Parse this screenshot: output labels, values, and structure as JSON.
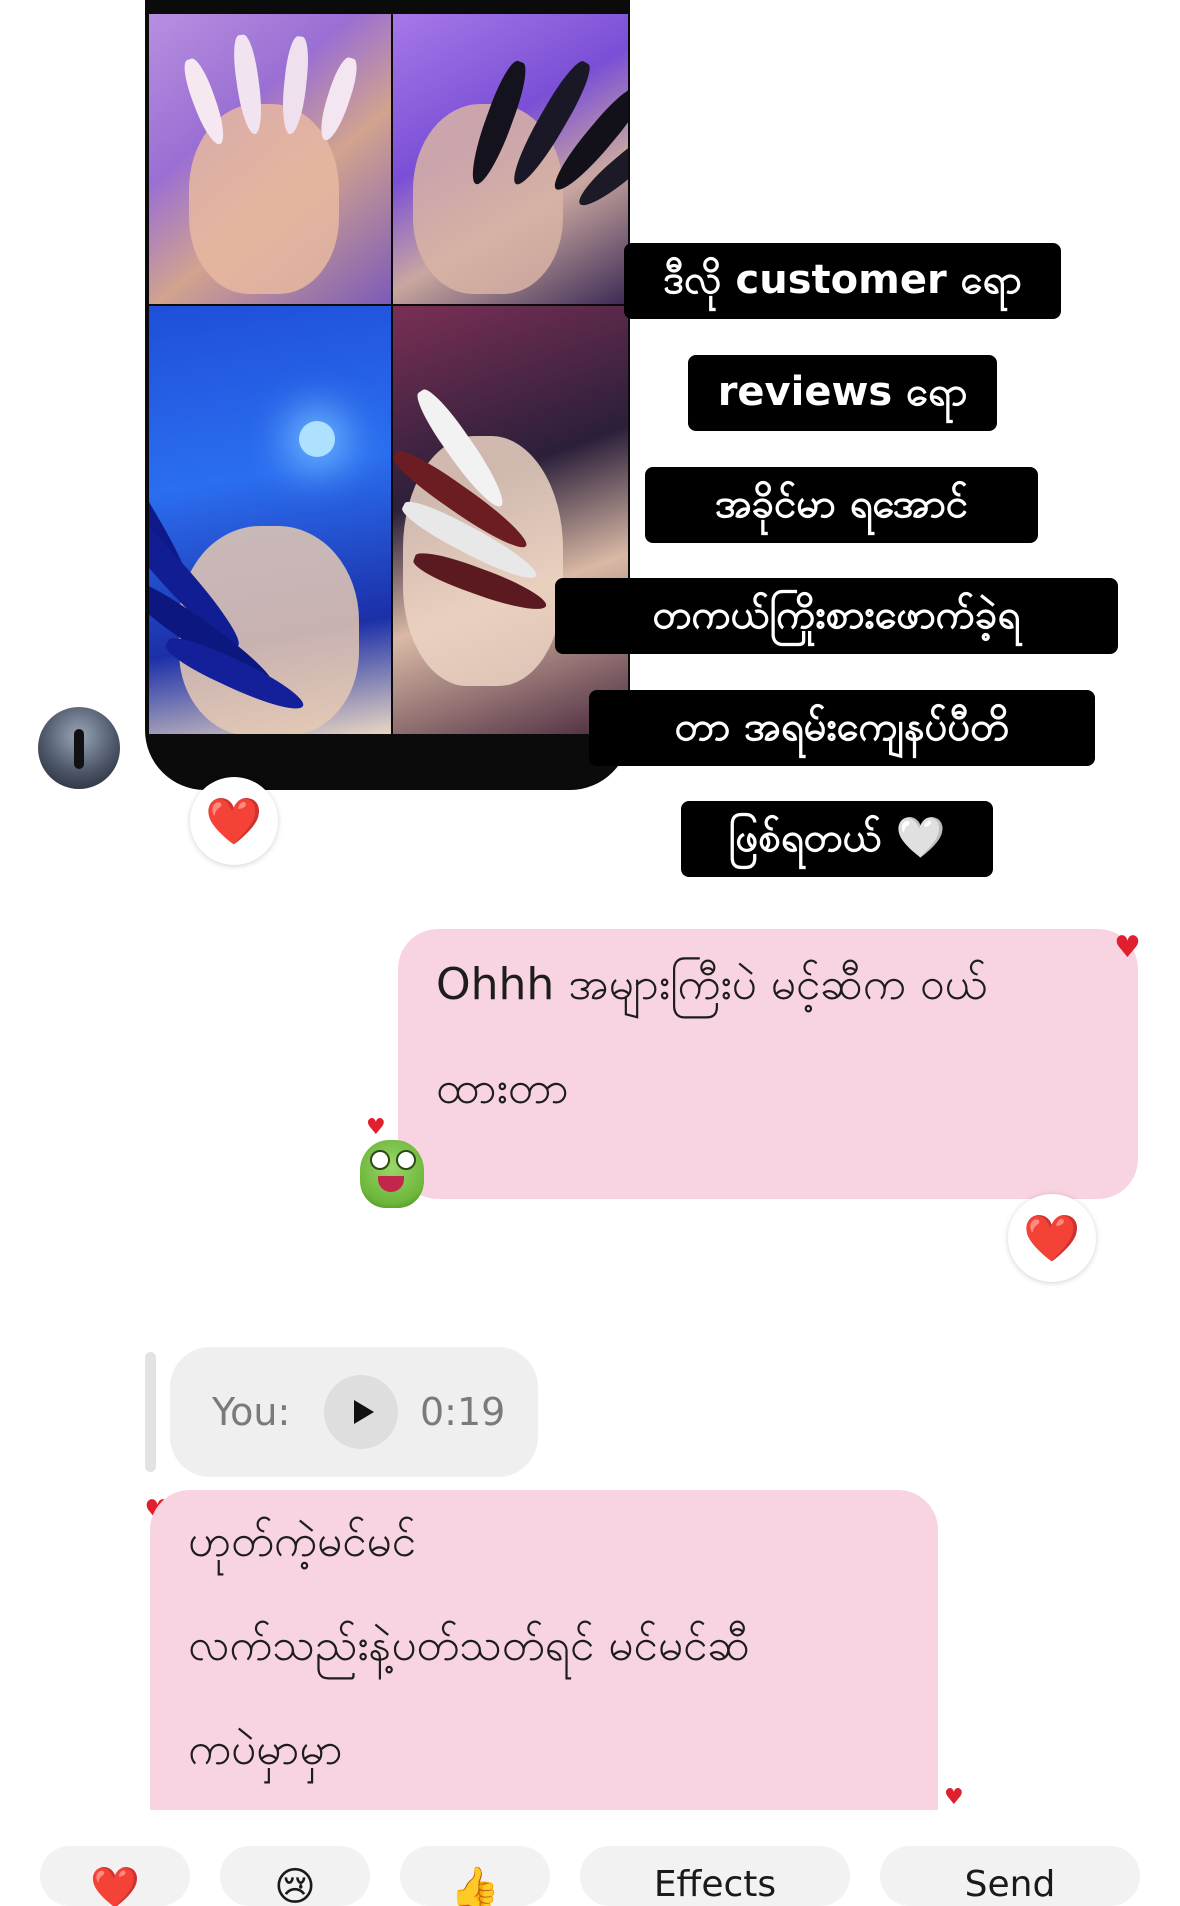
{
  "shared_image": {
    "captions": [
      "ဒီလို customer ရော",
      "reviews ရော",
      "အခိုင်မာ ရအောင်",
      "တကယ်ကြိုးစားဖောက်ခဲ့ရ",
      "တာ အရမ်းကျေနပ်ပီတိ",
      "ဖြစ်ရတယ် 🤍"
    ],
    "reaction": "❤️"
  },
  "messages": [
    {
      "sender": "me",
      "text_line1": "Ohhh အများကြီးပဲ မင့်ဆီက ဝယ်",
      "text_line2": "ထားတာ",
      "reaction": "❤️"
    },
    {
      "sender": "reply",
      "quoted_voice": {
        "label": "You:",
        "duration": "0:19"
      },
      "text_line1": "ဟုတ်ကဲ့မင်မင်",
      "text_line2": "လက်သည်းနဲ့ပတ်သတ်ရင် မင်မင်ဆီ",
      "text_line3": "ကပဲမှာမှာ"
    }
  ],
  "quick_reactions": [
    "❤️",
    "😢",
    "👍",
    "Effects",
    "Send"
  ],
  "colors": {
    "bubble_pink": "#f8d3e1",
    "voice_gray": "#efefef",
    "heart_red": "#e0202e",
    "caption_bg": "#000000"
  },
  "icons": [
    "heart-icon",
    "play-icon",
    "avatar",
    "frog-sticker-icon"
  ]
}
